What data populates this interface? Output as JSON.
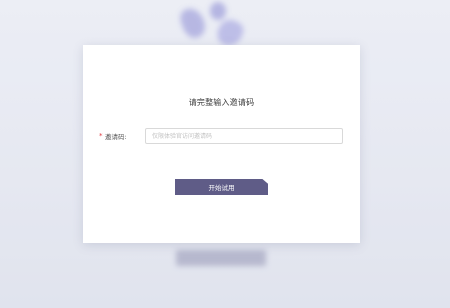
{
  "dialog": {
    "title": "请完整输入邀请码",
    "field": {
      "required_mark": "*",
      "label": "邀请码:",
      "value": "",
      "placeholder": "仅限体验官访问邀请码"
    },
    "submit_label": "开始试用"
  },
  "colors": {
    "accent": "#5f5c87",
    "required": "#e0383e",
    "background": "#e6e9f2"
  }
}
